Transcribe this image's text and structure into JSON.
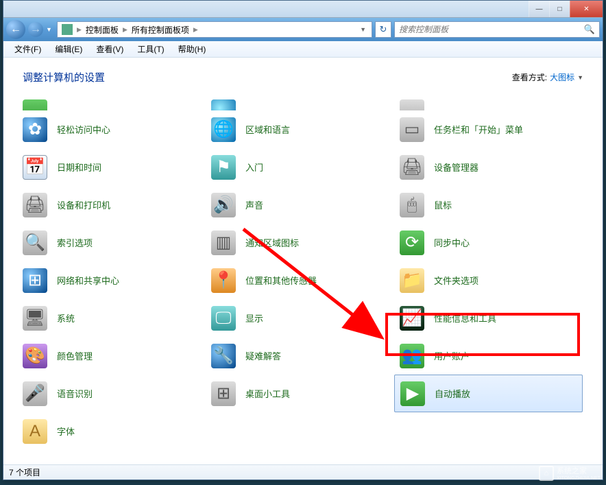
{
  "titlebar": {
    "minimize": "—",
    "maximize": "□",
    "close": "✕"
  },
  "nav": {
    "back": "←",
    "forward": "→",
    "dropdown": "▼",
    "refresh": "↻"
  },
  "breadcrumb": {
    "seg1": "控制面板",
    "seg2": "所有控制面板项",
    "sep": "▶"
  },
  "search": {
    "placeholder": "搜索控制面板",
    "icon": "🔍"
  },
  "menubar": {
    "file": "文件(F)",
    "edit": "编辑(E)",
    "view": "查看(V)",
    "tools": "工具(T)",
    "help": "帮助(H)"
  },
  "header": {
    "heading": "调整计算机的设置",
    "viewmode_label": "查看方式:",
    "viewmode_value": "大图标",
    "viewmode_dd": "▼"
  },
  "items": {
    "r0": {
      "c0_label": "",
      "c1_label": "",
      "c2_label": ""
    },
    "r1": {
      "c0_label": "轻松访问中心",
      "c1_label": "区域和语言",
      "c2_label": "任务栏和「开始」菜单"
    },
    "r2": {
      "c0_label": "日期和时间",
      "c1_label": "入门",
      "c2_label": "设备管理器"
    },
    "r3": {
      "c0_label": "设备和打印机",
      "c1_label": "声音",
      "c2_label": "鼠标"
    },
    "r4": {
      "c0_label": "索引选项",
      "c1_label": "通知区域图标",
      "c2_label": "同步中心"
    },
    "r5": {
      "c0_label": "网络和共享中心",
      "c1_label": "位置和其他传感器",
      "c2_label": "文件夹选项"
    },
    "r6": {
      "c0_label": "系统",
      "c1_label": "显示",
      "c2_label": "性能信息和工具"
    },
    "r7": {
      "c0_label": "颜色管理",
      "c1_label": "疑难解答",
      "c2_label": "用户账户"
    },
    "r8": {
      "c0_label": "语音识别",
      "c1_label": "桌面小工具",
      "c2_label": "自动播放"
    },
    "r9": {
      "c0_label": "字体"
    }
  },
  "statusbar": {
    "text": "7 个项目"
  },
  "watermark": {
    "text": "系统之家",
    "sub": "XITONGZHIJIA.NET"
  }
}
